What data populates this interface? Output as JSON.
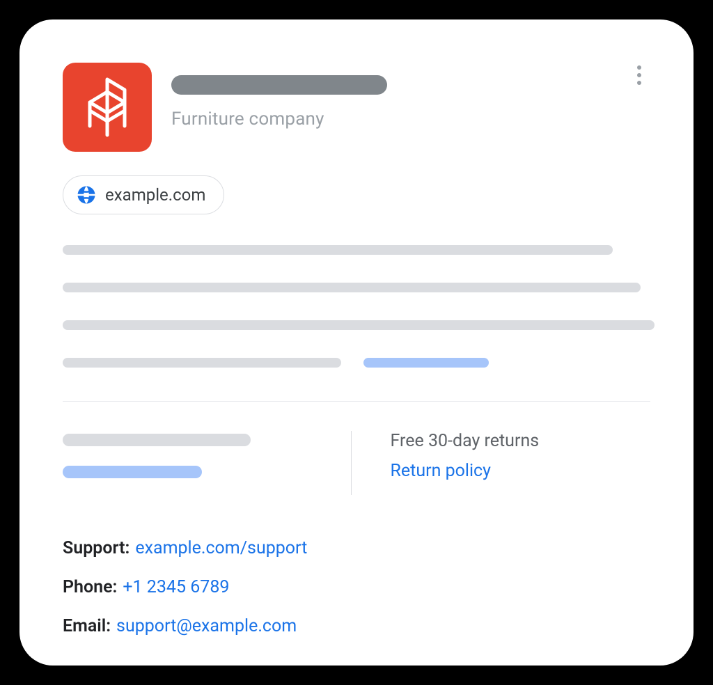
{
  "header": {
    "subtitle": "Furniture company"
  },
  "website_chip": {
    "url": "example.com"
  },
  "info_panel": {
    "returns_text": "Free 30-day returns",
    "return_policy_link": "Return policy"
  },
  "contact": {
    "support_label": "Support:",
    "support_link": "example.com/support",
    "phone_label": "Phone:",
    "phone_link": "+1 2345 6789",
    "email_label": "Email:",
    "email_link": "support@example.com"
  }
}
